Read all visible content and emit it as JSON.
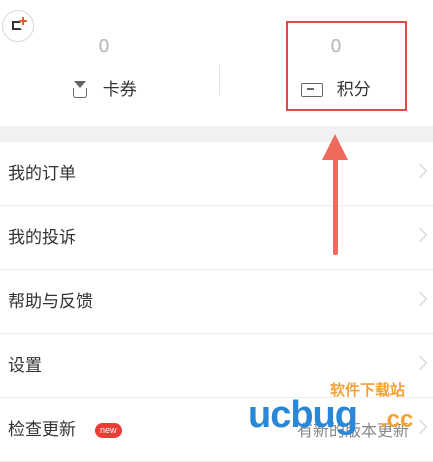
{
  "stats": {
    "coupon": {
      "value": "0",
      "label": "卡券",
      "icon": "coupon-icon"
    },
    "points": {
      "value": "0",
      "label": "积分",
      "icon": "points-ticket-icon"
    }
  },
  "corner_icon": "add-square-icon",
  "menu": {
    "items": [
      {
        "label": "我的订单"
      },
      {
        "label": "我的投诉"
      },
      {
        "label": "帮助与反馈"
      },
      {
        "label": "设置"
      },
      {
        "label": "检查更新",
        "badge": "new",
        "right_text": "有新的版本更新"
      }
    ]
  },
  "annotation": {
    "highlight_color": "#dc4b44",
    "arrow_color": "#ef6a5c"
  },
  "watermark": {
    "brand": "ucbug",
    "tld": ".cc",
    "cn_text": "软件下载站"
  }
}
